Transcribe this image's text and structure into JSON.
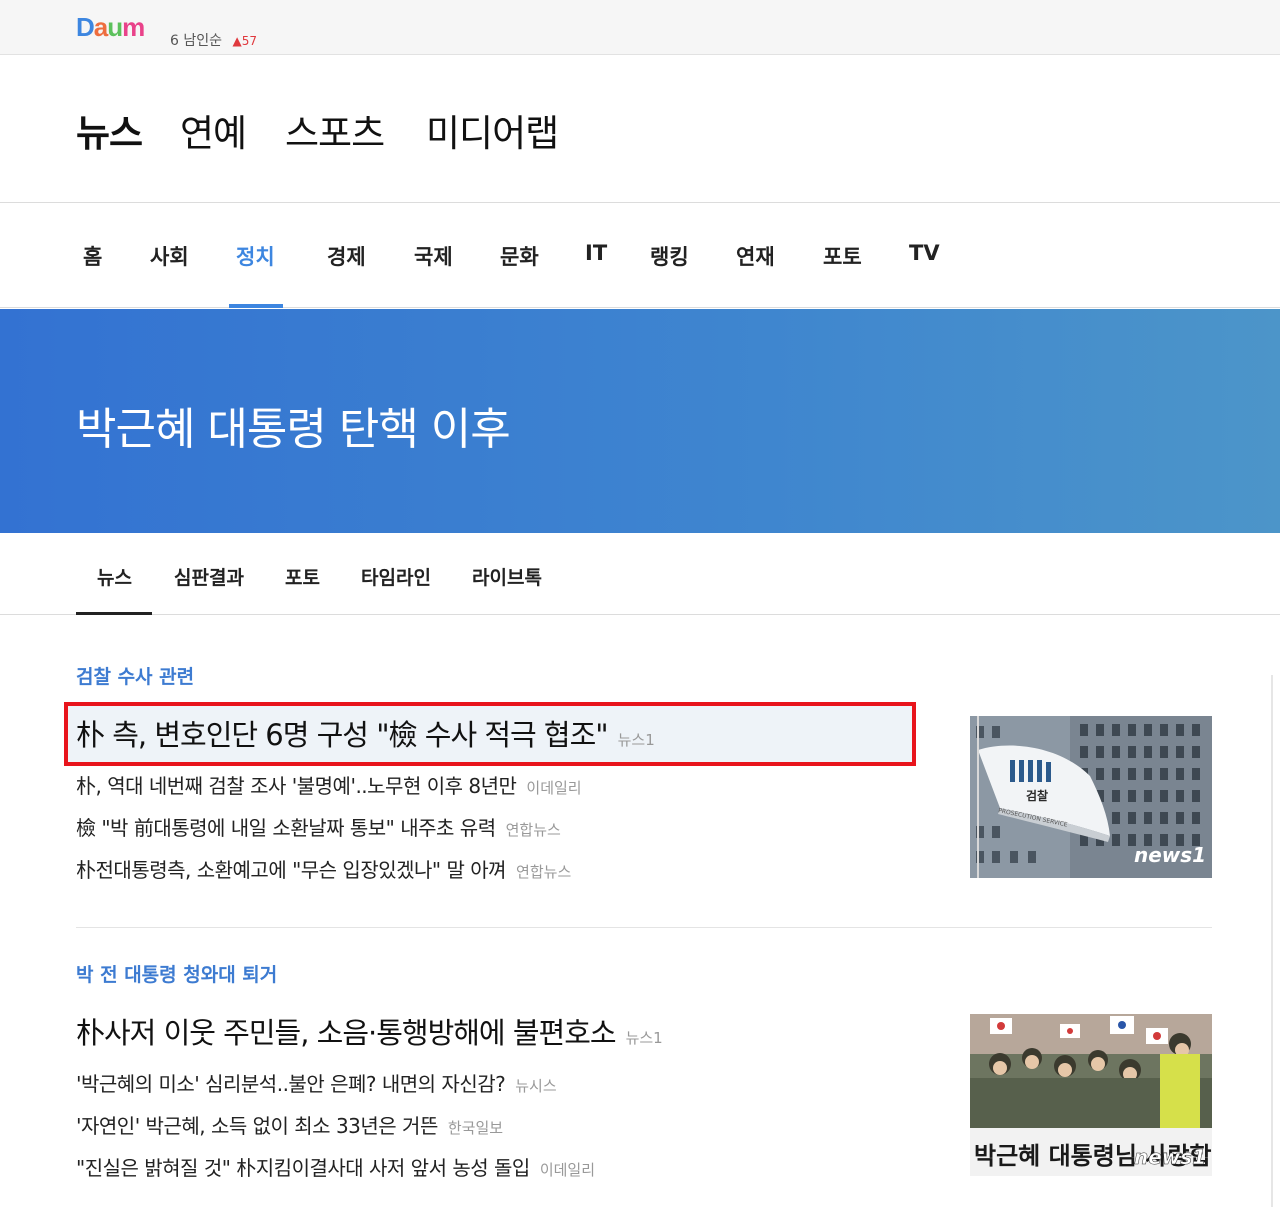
{
  "topbar": {
    "logo_letters": [
      "D",
      "a",
      "u",
      "m"
    ],
    "ticker_rank": "6",
    "ticker_text": "남인순",
    "ticker_change": "▲57"
  },
  "services": [
    {
      "label": "뉴스",
      "active": true
    },
    {
      "label": "연예",
      "active": false
    },
    {
      "label": "스포츠",
      "active": false
    },
    {
      "label": "미디어랩",
      "active": false
    }
  ],
  "gnb": [
    {
      "label": "홈"
    },
    {
      "label": "사회"
    },
    {
      "label": "정치"
    },
    {
      "label": "경제"
    },
    {
      "label": "국제"
    },
    {
      "label": "문화"
    },
    {
      "label": "IT"
    },
    {
      "label": "랭킹"
    },
    {
      "label": "연재"
    },
    {
      "label": "포토"
    },
    {
      "label": "TV"
    }
  ],
  "gnb_active": "정치",
  "banner": {
    "title": "박근혜 대통령 탄핵 이후"
  },
  "subtabs": [
    {
      "label": "뉴스"
    },
    {
      "label": "심판결과"
    },
    {
      "label": "포토"
    },
    {
      "label": "타임라인"
    },
    {
      "label": "라이브톡"
    }
  ],
  "sections": [
    {
      "title": "검찰 수사 관련",
      "headline": {
        "text": "朴 측, 변호인단 6명 구성 \"檢 수사 적극 협조\"",
        "source": "뉴스1"
      },
      "items": [
        {
          "text": "朴, 역대 네번째 검찰 조사 '불명예'..노무현 이후 8년만",
          "source": "이데일리"
        },
        {
          "text": "檢 \"박 前대통령에 내일 소환날짜 통보\" 내주초 유력",
          "source": "연합뉴스"
        },
        {
          "text": "朴전대통령측, 소환예고에 \"무슨 입장있겠나\" 말 아껴",
          "source": "연합뉴스"
        }
      ],
      "thumb": {
        "flag_text": "검찰",
        "flag_sub": "PROSECUTION SERVICE",
        "watermark": "news1"
      }
    },
    {
      "title": "박 전 대통령 청와대 퇴거",
      "headline": {
        "text": "朴사저 이웃 주민들, 소음·통행방해에 불편호소",
        "source": "뉴스1"
      },
      "items": [
        {
          "text": "'박근혜의 미소' 심리분석..불안 은폐? 내면의 자신감?",
          "source": "뉴시스"
        },
        {
          "text": "'자연인' 박근혜, 소득 없이 최소 33년은 거뜬",
          "source": "한국일보"
        },
        {
          "text": "\"진실은 밝혀질 것\" 朴지킴이결사대 사저 앞서 농성 돌입",
          "source": "이데일리"
        }
      ],
      "thumb": {
        "banner_text": "박근혜 대통령님 사랑합니다",
        "watermark": "news1"
      }
    }
  ],
  "colors": {
    "accent": "#3d86e0",
    "highlight_border": "#e8141c",
    "section_title": "#3d7bd1"
  }
}
